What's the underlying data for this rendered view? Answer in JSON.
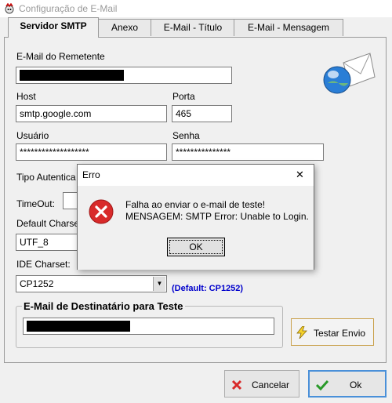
{
  "window": {
    "title": "Configuração de E-Mail"
  },
  "tabs": [
    {
      "label": "Servidor SMTP"
    },
    {
      "label": "Anexo"
    },
    {
      "label": "E-Mail - Título"
    },
    {
      "label": "E-Mail - Mensagem"
    }
  ],
  "form": {
    "sender_label": "E-Mail do Remetente",
    "host_label": "Host",
    "host_value": "smtp.google.com",
    "port_label": "Porta",
    "port_value": "465",
    "user_label": "Usuário",
    "user_value": "*******************",
    "password_label": "Senha",
    "password_value": "***************",
    "auth_label": "Tipo Autentica",
    "timeout_label": "TimeOut:",
    "default_charset_label": "Default Charse",
    "default_charset_value": "UTF_8",
    "ide_charset_label": "IDE Charset:",
    "ide_charset_value": "CP1252",
    "ide_charset_hint": "(Default: CP1252)",
    "test_group_title": "E-Mail de Destinatário para Teste",
    "test_button": "Testar Envio"
  },
  "footer": {
    "cancel_label": "Cancelar",
    "ok_label": "Ok"
  },
  "dialog": {
    "title": "Erro",
    "close_glyph": "✕",
    "message_line1": "Falha ao enviar o e-mail de teste!",
    "message_line2": "MENSAGEM: SMTP Error: Unable to Login.",
    "ok_label": "OK"
  },
  "colors": {
    "hint_blue": "#0000cc",
    "error_red": "#d82a2a",
    "ok_green": "#2a9a2a"
  }
}
